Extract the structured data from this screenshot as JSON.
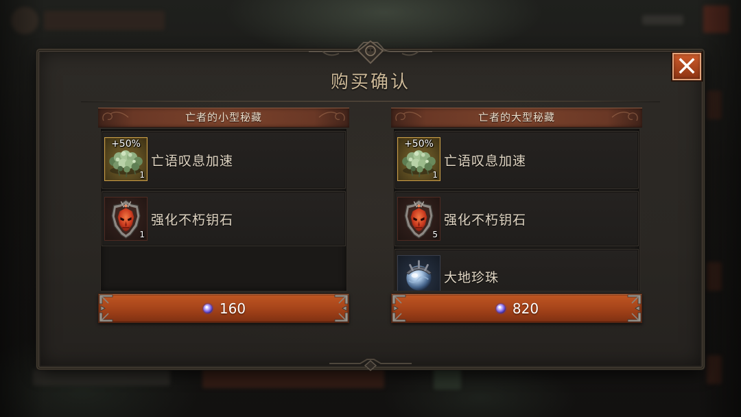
{
  "dialog": {
    "title": "购买确认",
    "close_icon": "close-icon"
  },
  "offers": [
    {
      "name": "亡者的小型秘藏",
      "items": [
        {
          "label": "亡语叹息加速",
          "badge": "+50%",
          "count": "1",
          "icon": "foliage-icon"
        },
        {
          "label": "强化不朽钥石",
          "count": "1",
          "icon": "demon-crest-icon"
        }
      ],
      "price": "160",
      "currency_icon": "purple-orb-icon"
    },
    {
      "name": "亡者的大型秘藏",
      "items": [
        {
          "label": "亡语叹息加速",
          "badge": "+50%",
          "count": "1",
          "icon": "foliage-icon"
        },
        {
          "label": "强化不朽钥石",
          "count": "5",
          "icon": "demon-crest-icon"
        },
        {
          "label": "大地珍珠",
          "icon": "pearl-icon"
        }
      ],
      "price": "820",
      "currency_icon": "purple-orb-icon"
    }
  ],
  "colors": {
    "title_text": "#cdb998",
    "header_bar": "#7a422b",
    "buy_button": "#a9461b",
    "close_button": "#a8441c",
    "panel_bg": "#2a2723",
    "rare_item_border": "#caa04a"
  }
}
